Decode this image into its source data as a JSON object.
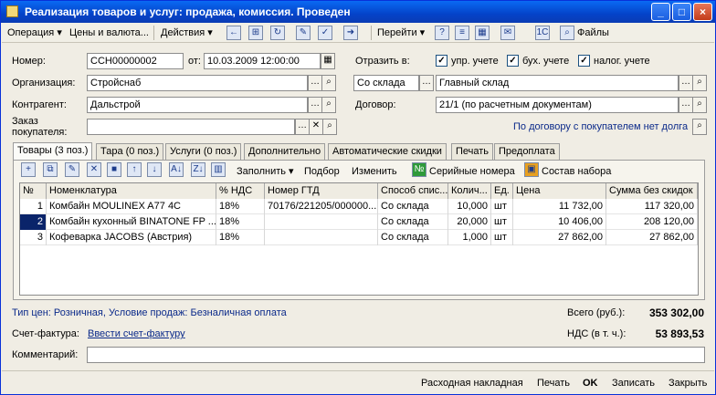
{
  "window": {
    "title": "Реализация товаров и услуг: продажа, комиссия. Проведен"
  },
  "toolbar": {
    "operation": "Операция ▾",
    "prices": "Цены и валюта...",
    "actions": "Действия ▾",
    "goto": "Перейти ▾",
    "help": "?",
    "files": "Файлы"
  },
  "form": {
    "number_label": "Номер:",
    "number_value": "ССН00000002",
    "date_label": "от:",
    "date_value": "10.03.2009 12:00:00",
    "reflect_label": "Отразить в:",
    "chk_upr": "упр. учете",
    "chk_buh": "бух. учете",
    "chk_nal": "налог. учете",
    "org_label": "Организация:",
    "org_value": "Стройснаб",
    "source_value": "Со склада",
    "warehouse_value": "Главный склад",
    "contractor_label": "Контрагент:",
    "contractor_value": "Дальстрой",
    "contract_label": "Договор:",
    "contract_value": "21/1 (по расчетным документам)",
    "order_label": "Заказ покупателя:",
    "debt_link": "По договору с покупателем нет долга"
  },
  "tabs": [
    "Товары (3 поз.)",
    "Тара (0 поз.)",
    "Услуги (0 поз.)",
    "Дополнительно",
    "Автоматические скидки",
    "Печать",
    "Предоплата"
  ],
  "grid_toolbar": {
    "fill": "Заполнить ▾",
    "select": "Подбор",
    "change": "Изменить",
    "serials": "Серийные номера",
    "kit": "Состав набора"
  },
  "table": {
    "columns": [
      "№",
      "Номенклатура",
      "% НДС",
      "Номер ГТД",
      "Способ спис...",
      "Колич...",
      "Ед.",
      "Цена",
      "Сумма без скидок"
    ],
    "rows": [
      [
        "1",
        "Комбайн MOULINEX A77 4C",
        "18%",
        "70176/221205/000000...",
        "Со склада",
        "10,000",
        "шт",
        "11 732,00",
        "117 320,00"
      ],
      [
        "2",
        "Комбайн кухонный BINATONE FP ...",
        "18%",
        "",
        "Со склада",
        "20,000",
        "шт",
        "10 406,00",
        "208 120,00"
      ],
      [
        "3",
        "Кофеварка JACOBS (Австрия)",
        "18%",
        "",
        "Со склада",
        "1,000",
        "шт",
        "27 862,00",
        "27 862,00"
      ]
    ]
  },
  "footer": {
    "price_type": "Тип цен: Розничная, Условие продаж: Безналичная оплата",
    "total_label": "Всего (руб.):",
    "total_value": "353 302,00",
    "invoice_label": "Счет-фактура:",
    "invoice_link": "Ввести счет-фактуру",
    "vat_label": "НДС (в т. ч.):",
    "vat_value": "53 893,53",
    "comment_label": "Комментарий:"
  },
  "status_buttons": {
    "waybill": "Расходная накладная",
    "print": "Печать",
    "ok": "OK",
    "save": "Записать",
    "close": "Закрыть"
  }
}
